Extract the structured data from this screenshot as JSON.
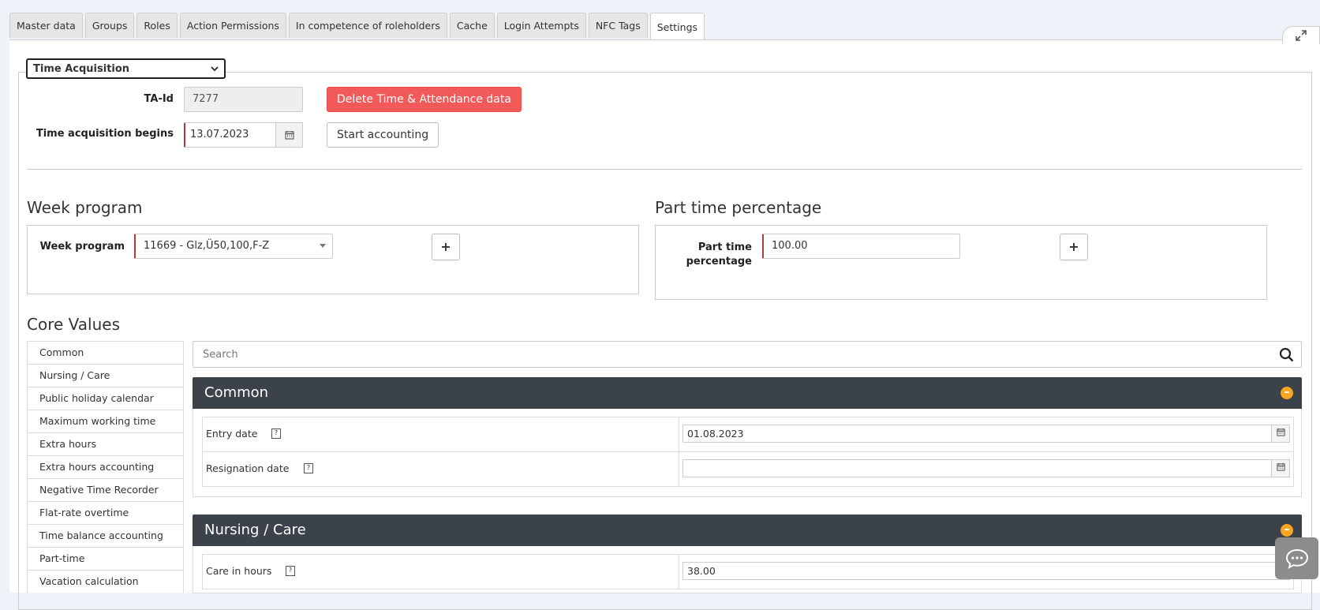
{
  "tabs": [
    {
      "label": "Master data"
    },
    {
      "label": "Groups"
    },
    {
      "label": "Roles"
    },
    {
      "label": "Action Permissions"
    },
    {
      "label": "In competence of roleholders"
    },
    {
      "label": "Cache"
    },
    {
      "label": "Login Attempts"
    },
    {
      "label": "NFC Tags"
    },
    {
      "label": "Settings",
      "active": true
    }
  ],
  "section_select": {
    "value": "Time Acquisition"
  },
  "ta": {
    "id_label": "TA-Id",
    "id_value": "7277",
    "begins_label": "Time acquisition begins",
    "begins_value": "13.07.2023",
    "delete_button": "Delete Time & Attendance data",
    "start_button": "Start accounting"
  },
  "week_program": {
    "heading": "Week program",
    "label": "Week program",
    "value": "11669 - Glz,Ü50,100,F-Z",
    "add_symbol": "+"
  },
  "part_time": {
    "heading": "Part time percentage",
    "label_line1": "Part time",
    "label_line2": "percentage",
    "value": "100.00",
    "add_symbol": "+"
  },
  "core_values": {
    "heading": "Core Values",
    "nav": [
      "Common",
      "Nursing / Care",
      "Public holiday calendar",
      "Maximum working time",
      "Extra hours",
      "Extra hours accounting",
      "Negative Time Recorder",
      "Flat-rate overtime",
      "Time balance accounting",
      "Part-time",
      "Vacation calculation"
    ],
    "search_placeholder": "Search",
    "sections": {
      "common": {
        "title": "Common",
        "rows": [
          {
            "name": "Entry date",
            "value": "01.08.2023"
          },
          {
            "name": "Resignation date",
            "value": ""
          }
        ]
      },
      "nursing": {
        "title": "Nursing / Care",
        "rows": [
          {
            "name": "Care in hours",
            "value": "38.00"
          }
        ]
      }
    }
  },
  "colors": {
    "danger": "#f25a5a",
    "section_header": "#3b4249",
    "collapse": "#f5a623",
    "required_border": "#b03a3a"
  }
}
